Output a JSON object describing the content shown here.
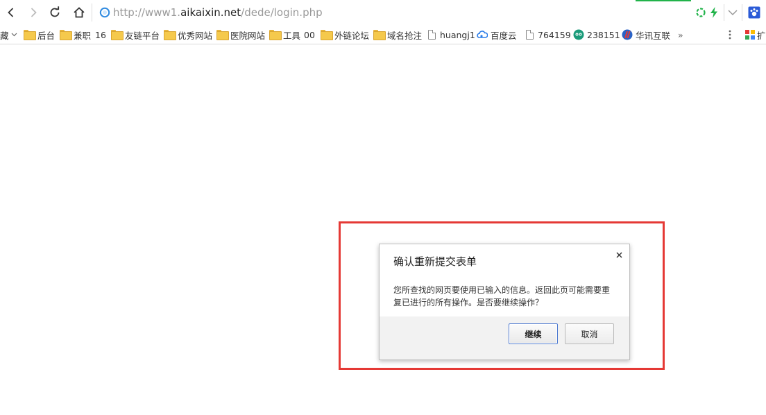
{
  "browser": {
    "url_prefix": "http://www1.",
    "url_domain": "aikaixin.net",
    "url_path": "/dede/login.php",
    "accent_color": "#21b34a",
    "bookmarks_overflow": "»",
    "extension_label": "扩"
  },
  "bookmarks": {
    "partial_label": "藏",
    "items": [
      {
        "type": "folder",
        "label": "后台"
      },
      {
        "type": "folder",
        "label": "兼职"
      },
      {
        "type": "text",
        "label": "16"
      },
      {
        "type": "folder",
        "label": "友链平台"
      },
      {
        "type": "folder",
        "label": "优秀网站"
      },
      {
        "type": "folder",
        "label": "医院网站"
      },
      {
        "type": "folder",
        "label": "工具"
      },
      {
        "type": "text",
        "label": "00"
      },
      {
        "type": "folder",
        "label": "外链论坛"
      },
      {
        "type": "folder",
        "label": "域名抢注"
      },
      {
        "type": "page",
        "label": "huangj1"
      },
      {
        "type": "site",
        "icon": "baidu-cloud-icon",
        "label": "百度云"
      },
      {
        "type": "page",
        "label": "764159"
      },
      {
        "type": "site",
        "icon": "site-logo-icon",
        "label": "238151"
      },
      {
        "type": "site",
        "icon": "huaxun-icon",
        "label": "华讯互联"
      }
    ]
  },
  "dialog": {
    "title": "确认重新提交表单",
    "message": "您所查找的网页要使用已输入的信息。返回此页可能需要重复已进行的所有操作。是否要继续操作？",
    "confirm_label": "继续",
    "cancel_label": "取消",
    "highlight_color": "#e53935"
  }
}
